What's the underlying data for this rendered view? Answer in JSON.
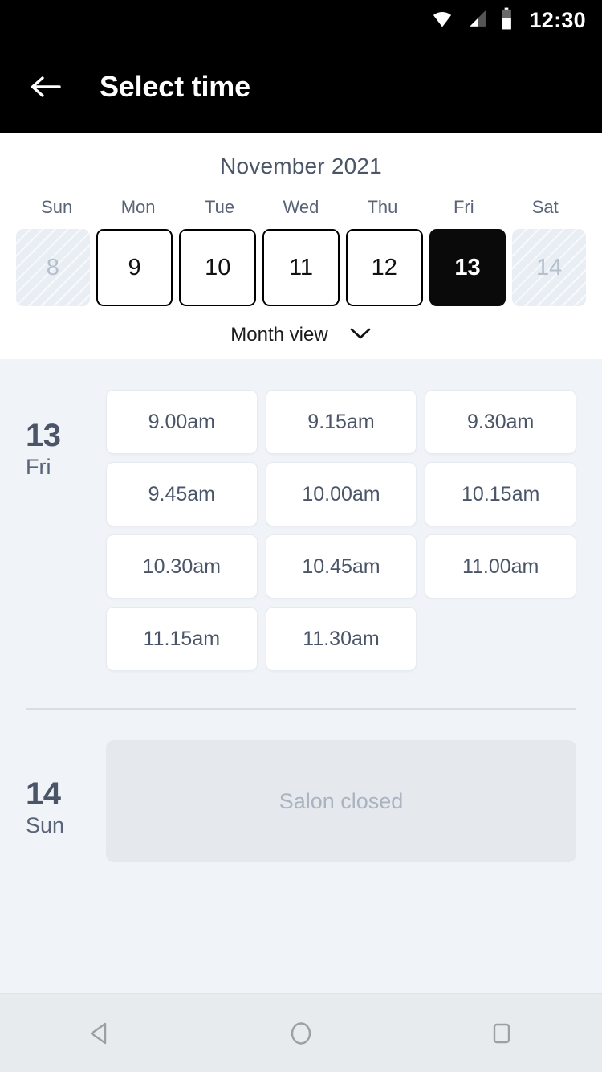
{
  "status_bar": {
    "time": "12:30",
    "icons": [
      "wifi-icon",
      "cellular-signal-icon",
      "battery-icon"
    ]
  },
  "app_bar": {
    "back_icon": "arrow-left-icon",
    "title": "Select time"
  },
  "calendar": {
    "month_year": "November 2021",
    "weekdays": [
      "Sun",
      "Mon",
      "Tue",
      "Wed",
      "Thu",
      "Fri",
      "Sat"
    ],
    "days": [
      {
        "number": "8",
        "state": "disabled"
      },
      {
        "number": "9",
        "state": "available"
      },
      {
        "number": "10",
        "state": "available"
      },
      {
        "number": "11",
        "state": "available"
      },
      {
        "number": "12",
        "state": "available"
      },
      {
        "number": "13",
        "state": "selected"
      },
      {
        "number": "14",
        "state": "disabled"
      }
    ],
    "view_toggle": {
      "label": "Month view",
      "icon": "chevron-down-icon"
    }
  },
  "schedule": {
    "groups": [
      {
        "day_number": "13",
        "day_name": "Fri",
        "slots": [
          "9.00am",
          "9.15am",
          "9.30am",
          "9.45am",
          "10.00am",
          "10.15am",
          "10.30am",
          "10.45am",
          "11.00am",
          "11.15am",
          "11.30am"
        ]
      },
      {
        "day_number": "14",
        "day_name": "Sun",
        "closed_message": "Salon closed"
      }
    ]
  },
  "nav_bar": {
    "buttons": [
      "back-triangle-icon",
      "home-circle-icon",
      "recents-square-icon"
    ]
  },
  "colors": {
    "app_bar_bg": "#000000",
    "page_bg": "#f0f3f7",
    "calendar_bg": "#ffffff",
    "selected_day_bg": "#0a0a0a",
    "text_primary": "#4a5568",
    "text_muted": "#aab3c0",
    "closed_box_bg": "#e5e9ee",
    "nav_bar_bg": "#e8ebee"
  }
}
